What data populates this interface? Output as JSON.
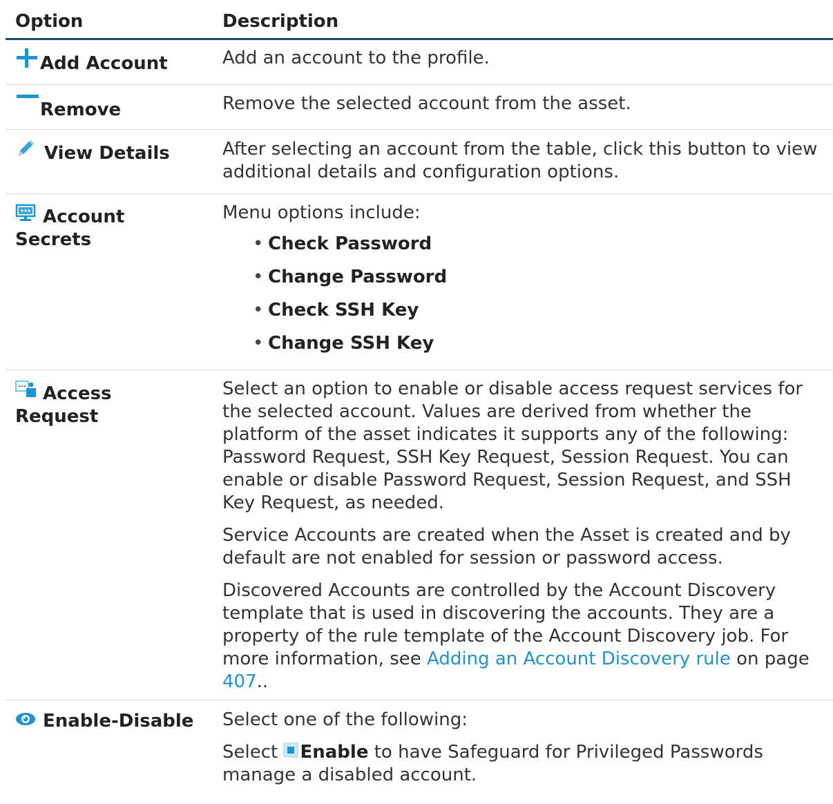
{
  "header": {
    "option": "Option",
    "description": "Description"
  },
  "rows": {
    "add": {
      "label": "Add Account",
      "icon": "plus-icon",
      "desc": "Add an account to the profile."
    },
    "remove": {
      "label": "Remove",
      "icon": "minus-icon",
      "desc": "Remove the selected account from the asset."
    },
    "view": {
      "label": "View Details",
      "icon": "pencil-icon",
      "desc": "After selecting an account from the table, click this button to view additional details and configuration options."
    },
    "secrets": {
      "label1": "Account",
      "label2": "Secrets",
      "icon": "monitor-password-icon",
      "desc": "Menu options include:",
      "items": [
        "Check Password",
        "Change Password",
        "Check SSH Key",
        "Change SSH Key"
      ]
    },
    "access": {
      "label1": "Access",
      "label2": "Request",
      "icon": "access-request-icon",
      "p1": "Select an option to enable or disable access request services for the selected account. Values are derived from whether the platform of the asset indicates it supports any of the following: Password Request, SSH Key Request, Session Request. You can enable or disable Password Request, Session Request, and SSH Key Request, as needed.",
      "p2": "Service Accounts are created when the Asset is created and by default are not enabled for session or password access.",
      "p3_before": "Discovered Accounts are controlled by the Account Discovery template that is used in discovering the accounts. They are a property of the rule template of the Account Discovery job. For more information, see ",
      "p3_link": "Adding an Account Discovery rule",
      "p3_mid": " on page ",
      "p3_page": "407",
      "p3_after": ".."
    },
    "enable": {
      "label": "Enable-Disable",
      "icon": "eye-icon",
      "desc1": "Select one of the following:",
      "desc2_before": "Select ",
      "desc2_bold": "Enable",
      "desc2_after": " to have Safeguard for Privileged Passwords manage a disabled account."
    }
  },
  "colors": {
    "accent": "#1a94d2",
    "header_rule": "#1e4a66",
    "text": "#333333"
  }
}
